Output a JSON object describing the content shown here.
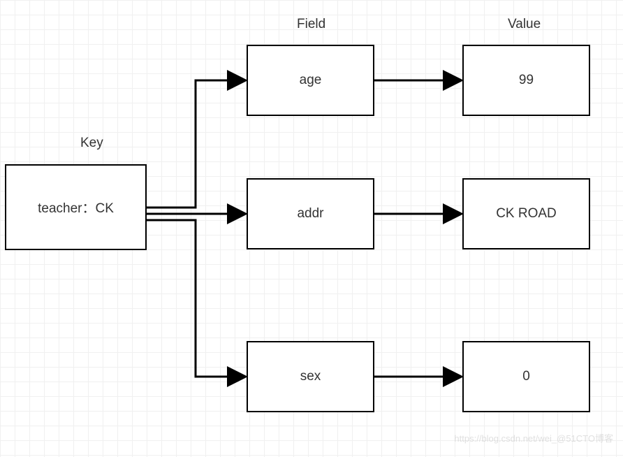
{
  "labels": {
    "key": "Key",
    "field": "Field",
    "value": "Value"
  },
  "key_box": {
    "text": "teacher：CK"
  },
  "fields": [
    {
      "name": "age",
      "value": "99"
    },
    {
      "name": "addr",
      "value": "CK ROAD"
    },
    {
      "name": "sex",
      "value": "0"
    }
  ],
  "watermark": "https://blog.csdn.net/wei_@51CTO博客"
}
